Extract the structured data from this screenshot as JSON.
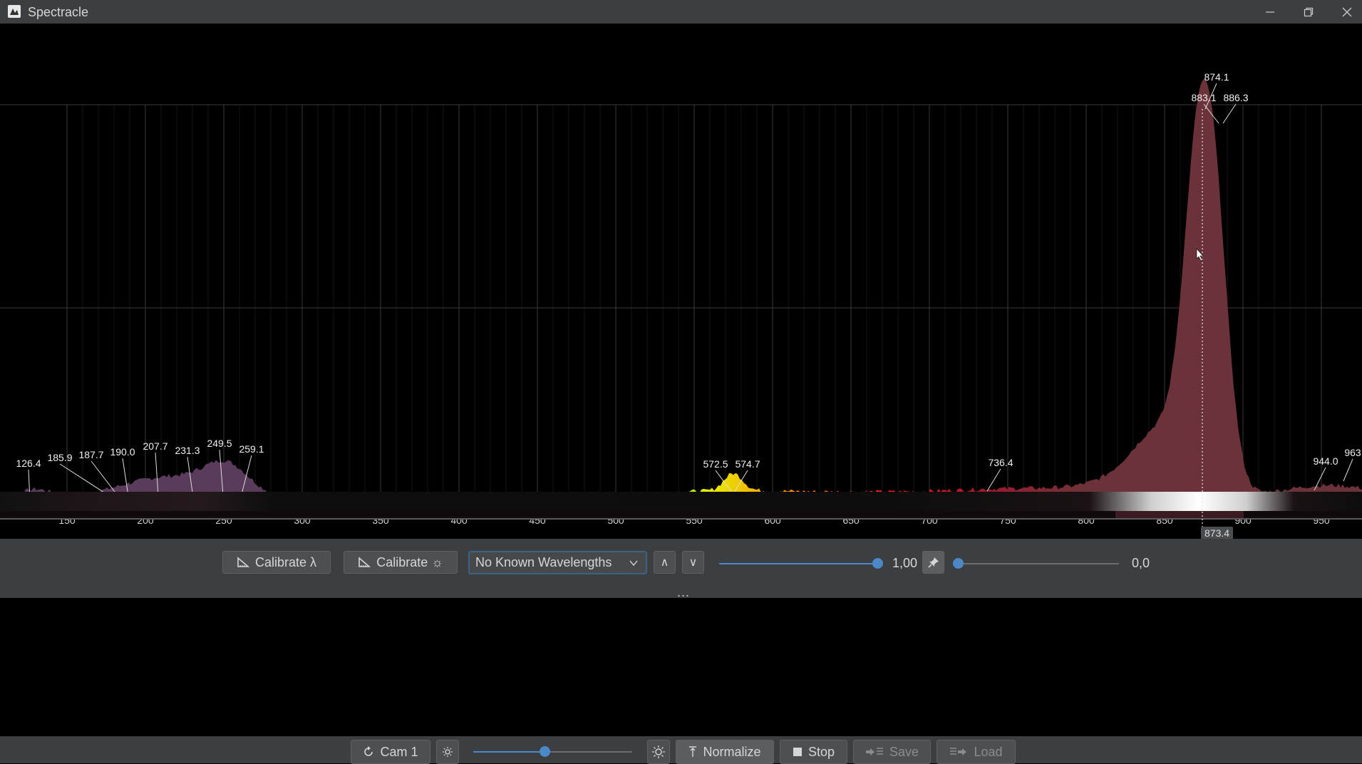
{
  "window": {
    "title": "Spectracle"
  },
  "spectrum": {
    "x_ticks": [
      "150",
      "200",
      "250",
      "300",
      "350",
      "400",
      "450",
      "500",
      "550",
      "600",
      "650",
      "700",
      "750",
      "800",
      "850",
      "900",
      "950"
    ],
    "peak_labels": [
      "126.4",
      "185.9",
      "187.7",
      "190.0",
      "207.7",
      "231.3",
      "249.5",
      "259.1",
      "572.5",
      "574.7",
      "736.4",
      "874.1",
      "883.1",
      "886.3",
      "944.0",
      "963"
    ],
    "cursor_readout": "873.4"
  },
  "controls": {
    "calibrate_wavelength": "Calibrate λ",
    "calibrate_intensity": "Calibrate ☼",
    "known_wavelengths": "No Known Wavelengths",
    "up_label": "∧",
    "down_label": "∨",
    "gain_value": "1,00",
    "offset_value": "0,0",
    "gain_level": 1.0,
    "offset_level": 0.0,
    "more": "..."
  },
  "toolbar": {
    "camera": "Cam 1",
    "normalize": "Normalize",
    "stop": "Stop",
    "save": "Save",
    "load": "Load",
    "exposure_level": 0.45
  },
  "icons": [
    "app-icon",
    "minimize-icon",
    "restore-icon",
    "close-icon",
    "ruler-icon",
    "sun-icon",
    "pin-icon",
    "refresh-icon",
    "brightness-low-icon",
    "brightness-high-icon",
    "normalize-icon",
    "stop-icon",
    "save-icon",
    "load-icon"
  ],
  "colors": {
    "accent": "#4a88c7",
    "panel": "#3c3f41",
    "peak_fill": "#6b3339"
  }
}
